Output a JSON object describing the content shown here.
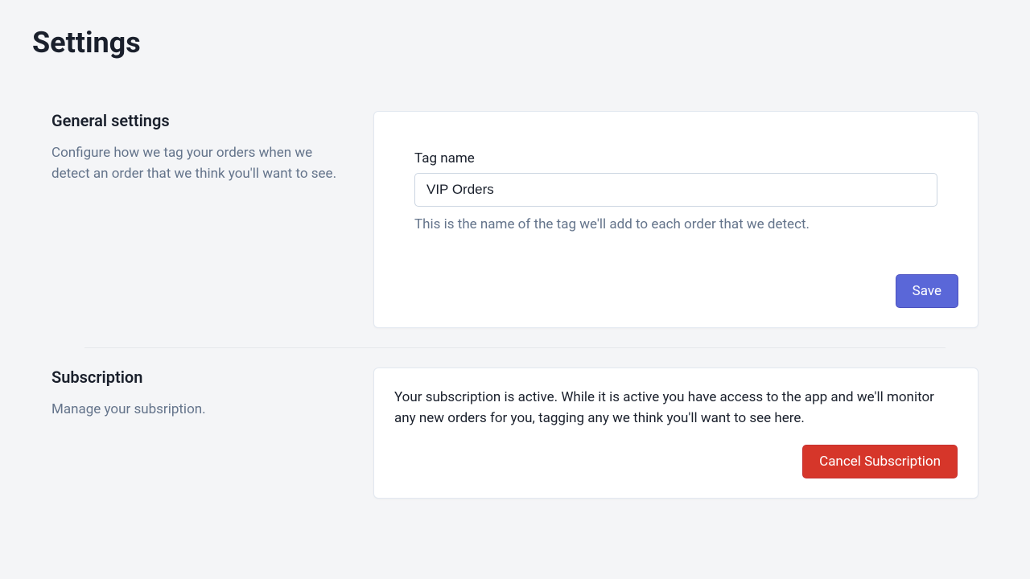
{
  "page": {
    "title": "Settings"
  },
  "general": {
    "heading": "General settings",
    "description": "Configure how we tag your orders when we detect an order that we think you'll want to see.",
    "tag_name_label": "Tag name",
    "tag_name_value": "VIP Orders",
    "tag_name_help": "This is the name of the tag we'll add to each order that we detect.",
    "save_label": "Save"
  },
  "subscription": {
    "heading": "Subscription",
    "description": "Manage your subsription.",
    "status_text": "Your subscription is active. While it is active you have access to the app and we'll monitor any new orders for you, tagging any we think you'll want to see here.",
    "cancel_label": "Cancel Subscription"
  }
}
